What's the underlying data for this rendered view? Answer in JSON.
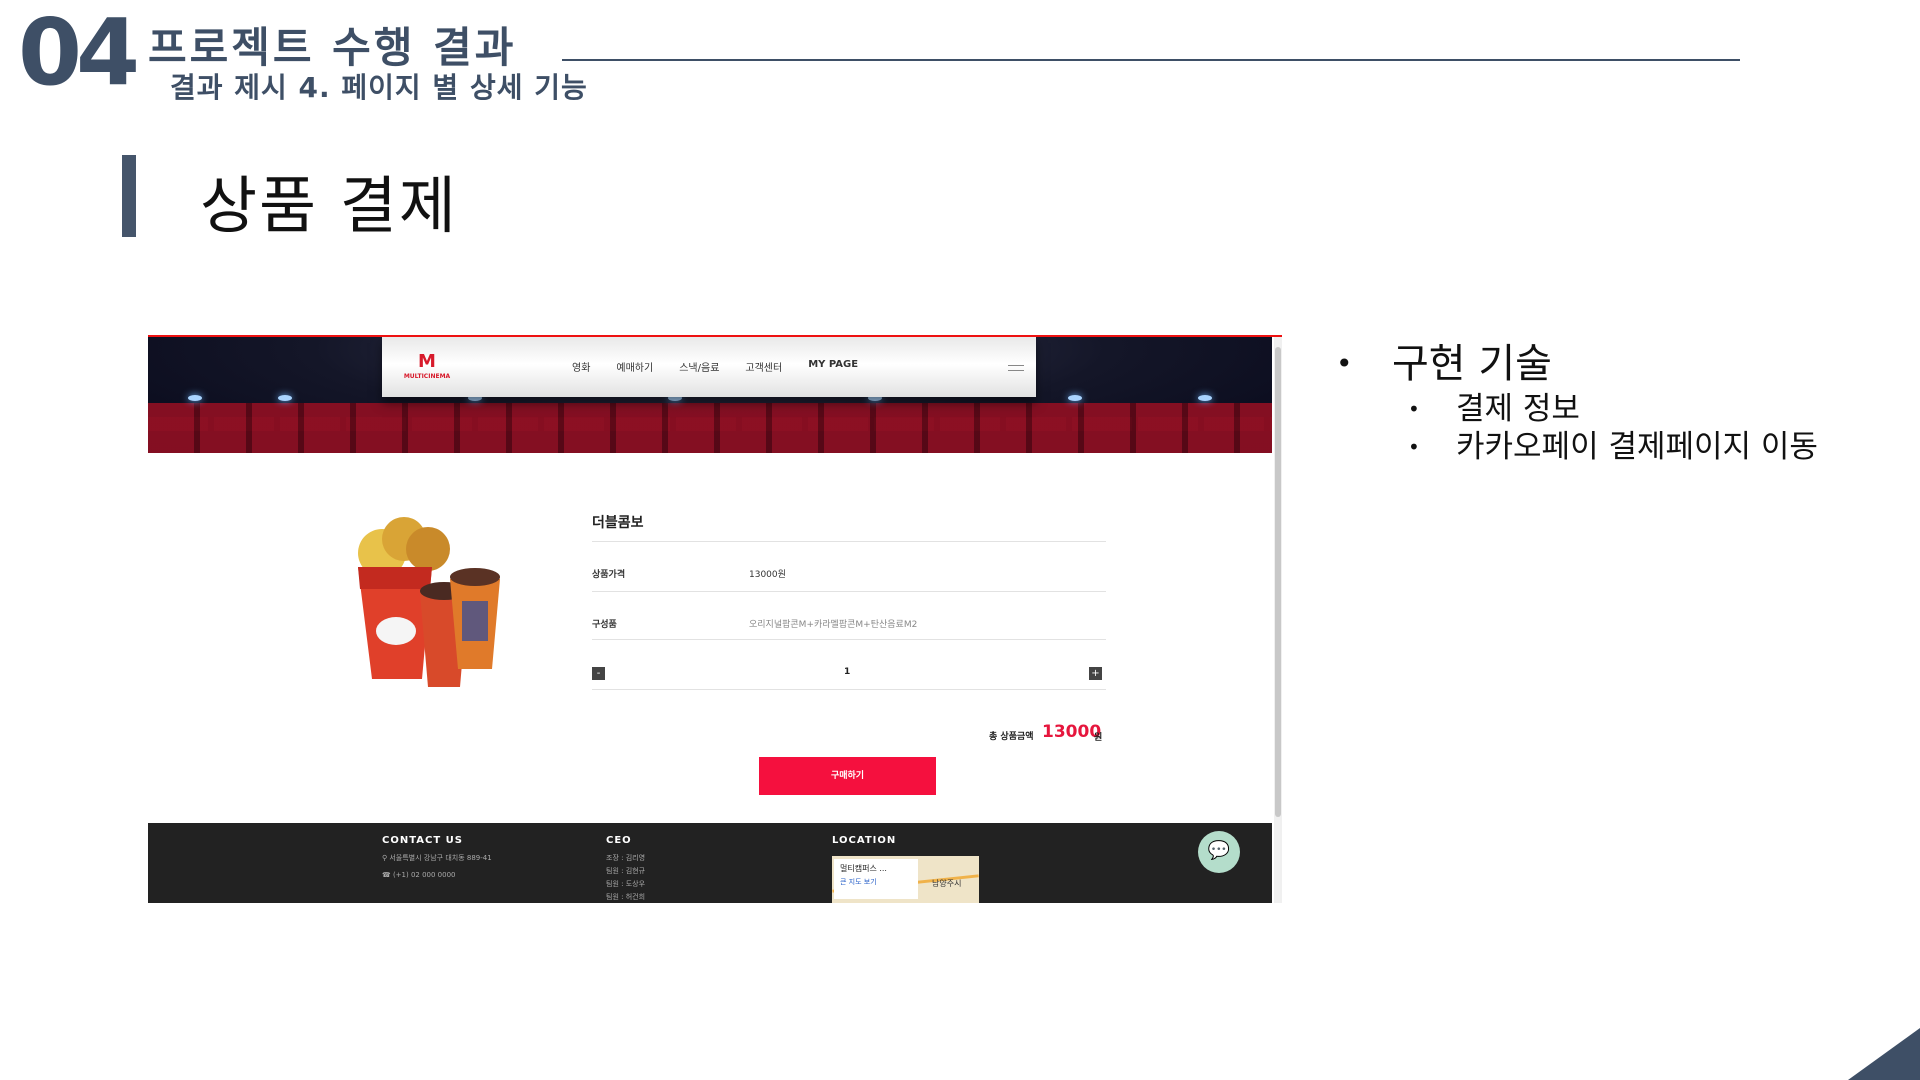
{
  "header": {
    "section_number": "04",
    "section_title": "프로젝트 수행 결과",
    "section_subtitle": "결과 제시 4. 페이지 별 상세 기능"
  },
  "page_title": "상품 결제",
  "screenshot": {
    "site": {
      "logo_text": "MULTICINEMA",
      "nav": [
        "영화",
        "예매하기",
        "스낵/음료",
        "고객센터",
        "MY PAGE"
      ]
    },
    "product": {
      "name": "더블콤보",
      "price_label": "상품가격",
      "price_value": "13000원",
      "components_label": "구성품",
      "components_value": "오리지널팝콘M+카라멜팝콘M+탄산음료M2",
      "qty_minus": "-",
      "qty_value": "1",
      "qty_plus": "+",
      "total_label": "총 상품금액",
      "total_value": "13000",
      "total_unit": "원",
      "buy_button": "구매하기"
    },
    "footer": {
      "contact_head": "CONTACT US",
      "contact_address": "서울특별시 강남구 대치동 889-41",
      "contact_phone": "(+1) 02 000 0000",
      "ceo_head": "CEO",
      "ceo_lines": [
        "조장 : 김리영",
        "팀원 : 김현규",
        "팀원 : 도상우",
        "팀원 : 허건희"
      ],
      "location_head": "LOCATION",
      "map_place": "멀티캠퍼스 ...",
      "map_link": "큰 지도 보기",
      "map_area": "남양주시"
    }
  },
  "bullets": {
    "main": "구현 기술",
    "subs": [
      "결제 정보",
      "카카오페이 결제페이지 이동"
    ]
  },
  "colors": {
    "navy": "#3e4f66",
    "accent_red": "#f5103e",
    "footer_bg": "#222222"
  }
}
